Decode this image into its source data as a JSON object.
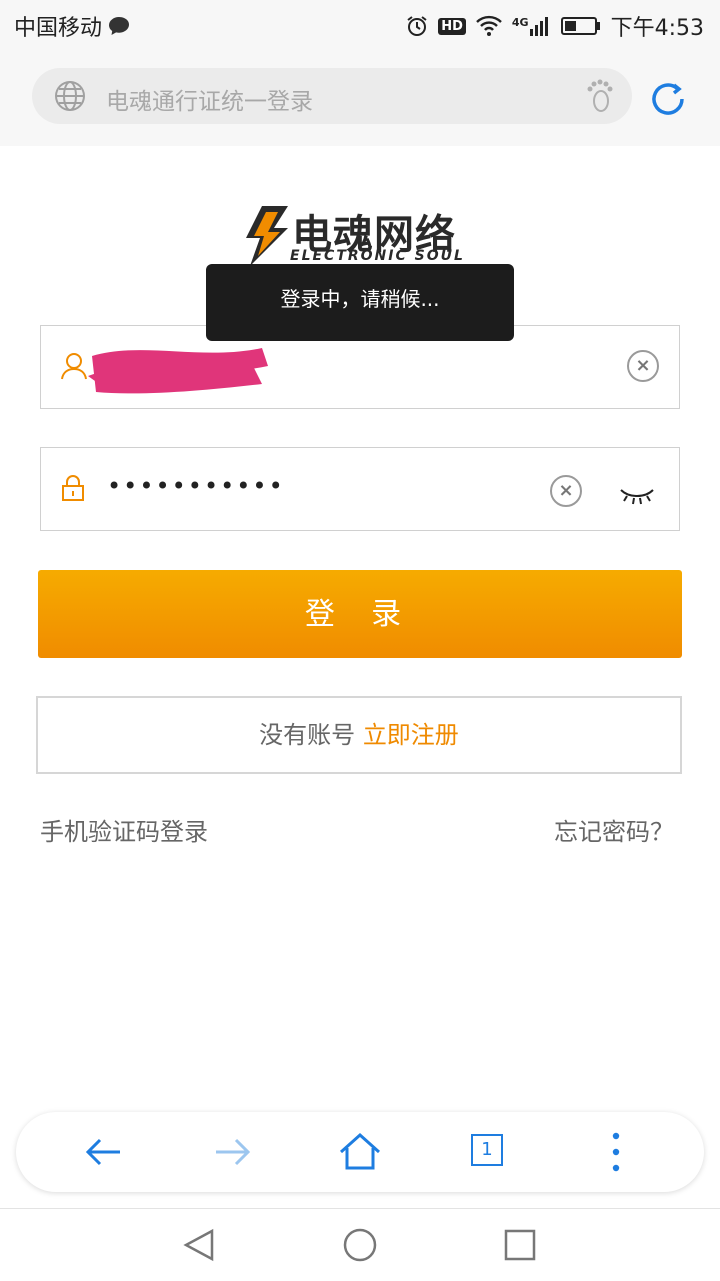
{
  "status_bar": {
    "carrier": "中国移动",
    "hd_badge": "HD",
    "network": "4G",
    "time": "下午4:53"
  },
  "address_bar": {
    "url_text": "电魂通行证统一登录"
  },
  "logo": {
    "brand_name": "电魂网络",
    "brand_sub": "ELECTRONIC SOUL"
  },
  "toast": {
    "message": "登录中，请稍候..."
  },
  "login_form": {
    "password_value": "•••••••••••",
    "clear_symbol": "×",
    "login_button_label": "登 录",
    "register_prompt": "没有账号",
    "register_link": "立即注册",
    "sms_login_link": "手机验证码登录",
    "forgot_password_link": "忘记密码？"
  },
  "browser_toolbar": {
    "tab_count": "1"
  },
  "colors": {
    "accent_orange": "#f08c00",
    "link_blue": "#1e7de0",
    "redaction_pink": "#e0357a"
  }
}
